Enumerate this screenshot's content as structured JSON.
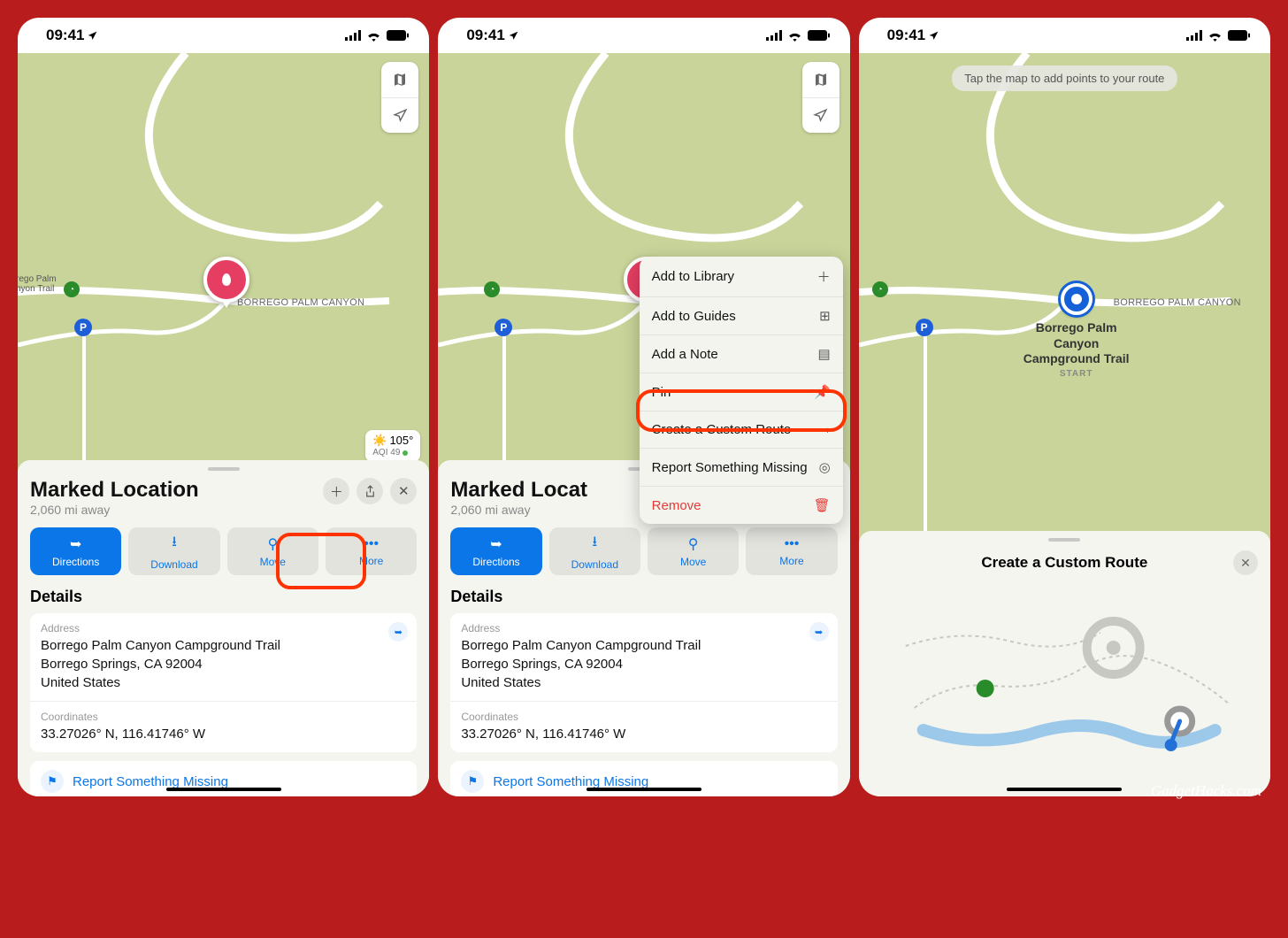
{
  "statusBar": {
    "time": "09:41"
  },
  "map": {
    "roadLabel": "BORREGO PALM CANYON",
    "trailLabel1": "rego Palm",
    "trailLabel2": "nyon Trail",
    "weather": {
      "temp": "105°",
      "aqi": "AQI 49"
    }
  },
  "sheet": {
    "title": "Marked Location",
    "subtitle": "2,060 mi away",
    "actions": {
      "directions": "Directions",
      "download": "Download",
      "move": "Move",
      "more": "More"
    },
    "detailsHeading": "Details",
    "address": {
      "label": "Address",
      "line1": "Borrego Palm Canyon Campground Trail",
      "line2": "Borrego Springs, CA  92004",
      "line3": "United States"
    },
    "coordinates": {
      "label": "Coordinates",
      "value": "33.27026° N, 116.41746° W"
    },
    "report": "Report Something Missing",
    "pin": "Pin"
  },
  "menu": {
    "addLibrary": "Add to Library",
    "addGuides": "Add to Guides",
    "addNote": "Add a Note",
    "pin": "Pin",
    "customRoute": "Create a Custom Route",
    "reportMissing": "Report Something Missing",
    "remove": "Remove"
  },
  "screen3": {
    "instruction": "Tap the map to add points to your route",
    "sheetTitle": "Create a Custom Route",
    "startLabel": "Borrego Palm Canyon Campground Trail",
    "startSub": "START"
  },
  "watermark": "GadgetHacks.com"
}
